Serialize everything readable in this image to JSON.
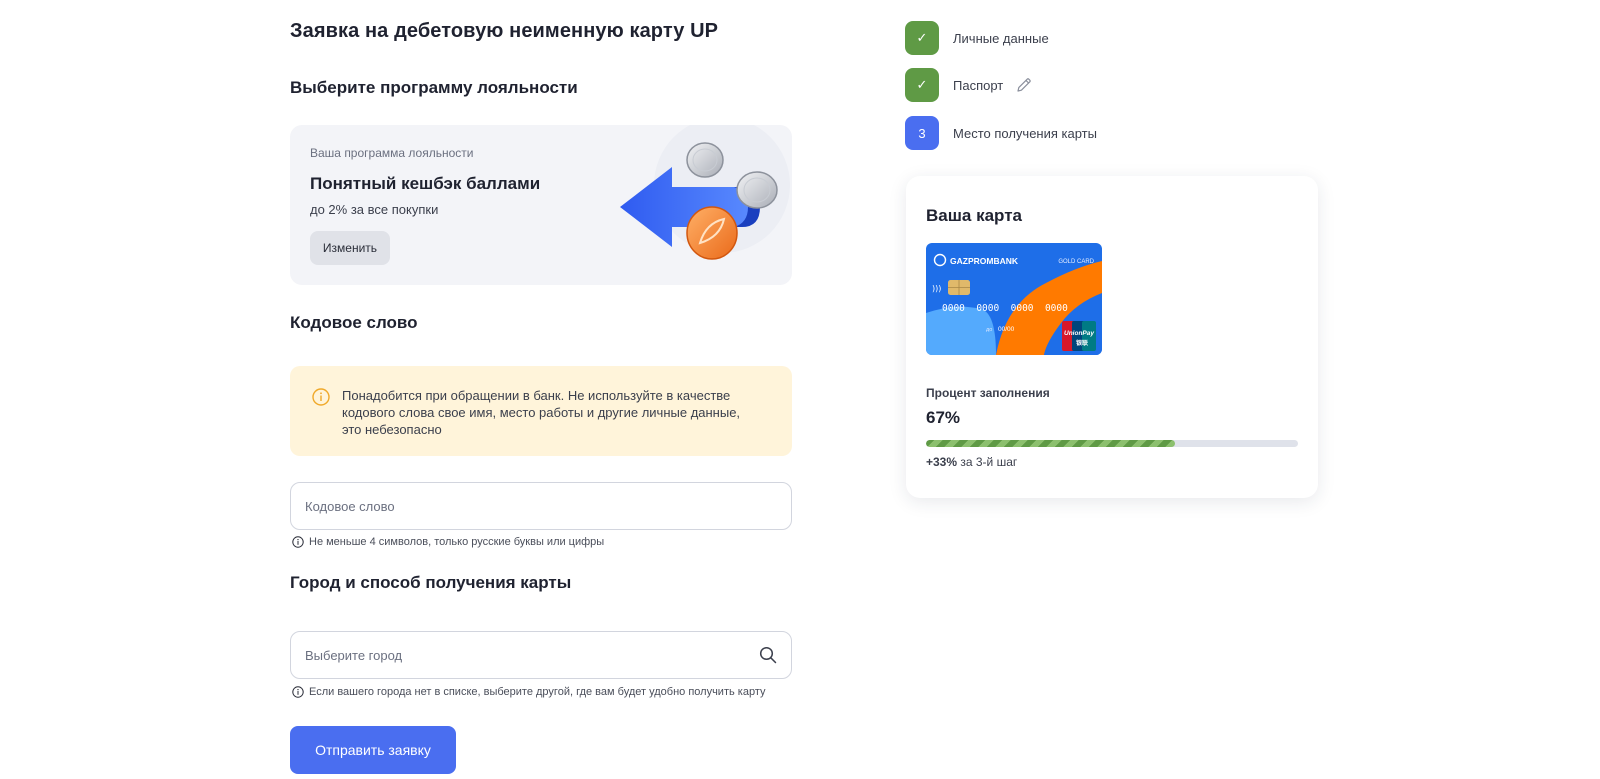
{
  "page": {
    "title": "Заявка на дебетовую неименную карту UP"
  },
  "loyalty": {
    "section_title": "Выберите программу лояльности",
    "eyebrow": "Ваша программа лояльности",
    "title": "Понятный кешбэк баллами",
    "subtitle": "до 2% за все покупки",
    "change_button": "Изменить"
  },
  "code_word": {
    "section_title": "Кодовое слово",
    "warning": "Понадобится при обращении в банк. Не используйте в качестве кодового слова свое имя, место работы и другие личные данные, это небезопасно",
    "placeholder": "Кодовое слово",
    "value": "",
    "hint": "Не меньше 4 символов, только русские буквы или цифры"
  },
  "city": {
    "section_title": "Город и способ получения карты",
    "placeholder": "Выберите город",
    "value": "",
    "hint": "Если вашего города нет в списке, выберите другой, где вам будет удобно получить карту"
  },
  "submit_button": "Отправить заявку",
  "steps": [
    {
      "badge": "✓",
      "label": "Личные данные",
      "status": "done"
    },
    {
      "badge": "✓",
      "label": "Паспорт",
      "status": "done"
    },
    {
      "badge": "3",
      "label": "Место получения карты",
      "status": "active"
    }
  ],
  "card_panel": {
    "title": "Ваша карта",
    "card": {
      "brand": "GAZPROMBANK",
      "tier": "GOLD CARD",
      "number": "0000  0000  0000  0000",
      "expiry_label": "до",
      "expiry": "00/00",
      "network": "UnionPay",
      "network_sub": "银联"
    },
    "fill_label": "Процент заполнения",
    "fill_value": "67%",
    "fill_fraction": 0.67,
    "progress_delta": "+33%",
    "progress_note": "за 3-й шаг"
  },
  "colors": {
    "primary": "#4a6ef0",
    "success": "#5f9a45",
    "warning_bg": "#fff4da",
    "card_blue": "#1e6ee8",
    "card_orange": "#ff7a00"
  }
}
